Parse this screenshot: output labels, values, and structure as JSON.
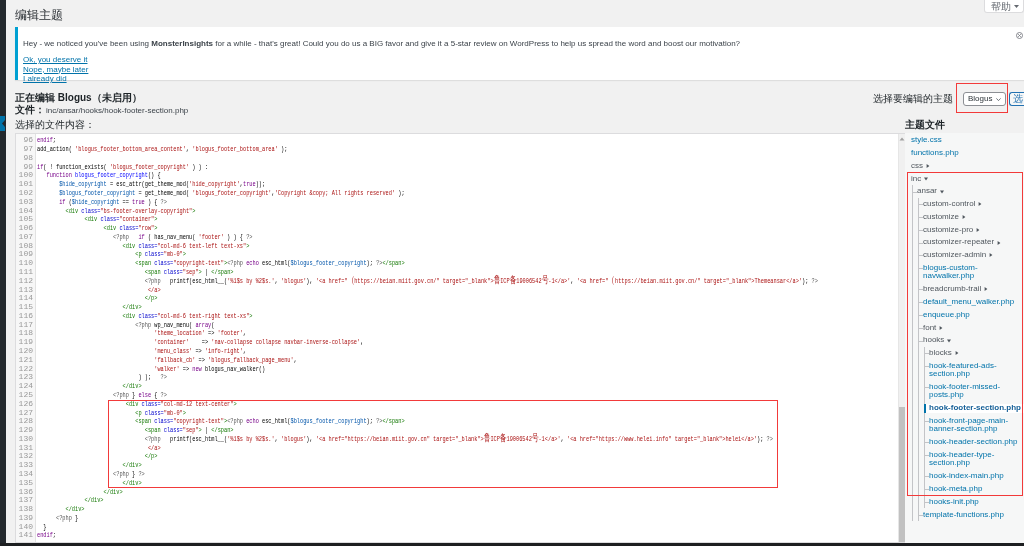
{
  "page": {
    "title": "编辑主题",
    "help_button": "帮助"
  },
  "notice": {
    "message": "Hey - we noticed you've been using **MonsterInsights** for a while - that's great! Could you do us a BIG favor and give it a 5-star review on WordPress to help us spread the word and boost our motivation?",
    "links": [
      "Ok, you deserve it",
      "Nope, maybe later",
      "I already did"
    ]
  },
  "editor_header": {
    "title": "正在编辑 Blogus（未启用）",
    "file_label": "文件：",
    "file_path": "inc/ansar/hooks/hook-footer-section.php",
    "theme_picker": {
      "label": "选择要编辑的主题",
      "value": "Blogus",
      "button": "选"
    }
  },
  "code_editor": {
    "label": "选择的文件内容：",
    "lines": [
      {
        "number": "96",
        "tokens": [
          {
            "kind": "keyword",
            "text": "endif"
          },
          {
            "kind": "plain",
            "text": ";"
          }
        ]
      },
      {
        "number": "97",
        "tokens": [
          {
            "kind": "plain",
            "text": "add_action( "
          },
          {
            "kind": "string",
            "text": "'blogus_footer_bottom_area_content'"
          },
          {
            "kind": "plain",
            "text": ", "
          },
          {
            "kind": "string",
            "text": "'blogus_footer_bottom_area'"
          },
          {
            "kind": "plain",
            "text": " );"
          }
        ]
      },
      {
        "number": "98"
      },
      {
        "number": "99",
        "tokens": [
          {
            "kind": "keyword",
            "text": "if"
          },
          {
            "kind": "plain",
            "text": "( ! function_exists( "
          },
          {
            "kind": "string",
            "text": "'blogus_footer_copyright'"
          },
          {
            "kind": "plain",
            "text": " ) ) :"
          }
        ]
      },
      {
        "number": "100",
        "tokens": [
          {
            "kind": "keyword",
            "text": "   function "
          },
          {
            "kind": "def",
            "text": "blogus_footer_copyright"
          },
          {
            "kind": "plain",
            "text": "() {"
          }
        ]
      },
      {
        "number": "101",
        "tokens": [
          {
            "kind": "variable",
            "text": "       $hide_copyright"
          },
          {
            "kind": "plain",
            "text": " = esc_attr(get_theme_mod("
          },
          {
            "kind": "string",
            "text": "'hide_copyright'"
          },
          {
            "kind": "plain",
            "text": ","
          },
          {
            "kind": "keyword",
            "text": "true"
          },
          {
            "kind": "plain",
            "text": "));"
          }
        ]
      },
      {
        "number": "102",
        "tokens": [
          {
            "kind": "variable",
            "text": "       $blogus_footer_copyright"
          },
          {
            "kind": "plain",
            "text": " = get_theme_mod( "
          },
          {
            "kind": "string",
            "text": "'blogus_footer_copyright'"
          },
          {
            "kind": "plain",
            "text": ","
          },
          {
            "kind": "string",
            "text": "'Copyright &copy; All rights reserved'"
          },
          {
            "kind": "plain",
            "text": " );"
          }
        ]
      },
      {
        "number": "103",
        "tokens": [
          {
            "kind": "keyword",
            "text": "       if"
          },
          {
            "kind": "plain",
            "text": " ("
          },
          {
            "kind": "variable",
            "text": "$hide_copyright"
          },
          {
            "kind": "plain",
            "text": " == "
          },
          {
            "kind": "keyword",
            "text": "true"
          },
          {
            "kind": "plain",
            "text": " ) { "
          },
          {
            "kind": "meta",
            "text": "?>"
          }
        ]
      },
      {
        "number": "104",
        "tokens": [
          {
            "kind": "tag",
            "text": "         <div "
          },
          {
            "kind": "attribute",
            "text": "class="
          },
          {
            "kind": "string",
            "text": "\"bs-footer-overlay-copyright\""
          },
          {
            "kind": "tag",
            "text": ">"
          }
        ]
      },
      {
        "number": "105",
        "tokens": [
          {
            "kind": "tag",
            "text": "               <div "
          },
          {
            "kind": "attribute",
            "text": "class="
          },
          {
            "kind": "string",
            "text": "\"container\""
          },
          {
            "kind": "tag",
            "text": ">"
          }
        ]
      },
      {
        "number": "106",
        "tokens": [
          {
            "kind": "tag",
            "text": "                     <div "
          },
          {
            "kind": "attribute",
            "text": "class="
          },
          {
            "kind": "string",
            "text": "\"row\""
          },
          {
            "kind": "tag",
            "text": ">"
          }
        ]
      },
      {
        "number": "107",
        "tokens": [
          {
            "kind": "meta",
            "text": "                        <?php   "
          },
          {
            "kind": "keyword",
            "text": "if"
          },
          {
            "kind": "plain",
            "text": " ( has_nav_menu( "
          },
          {
            "kind": "string",
            "text": "'footer'"
          },
          {
            "kind": "plain",
            "text": " ) ) { "
          },
          {
            "kind": "meta",
            "text": "?>"
          }
        ]
      },
      {
        "number": "108",
        "tokens": [
          {
            "kind": "tag",
            "text": "                           <div "
          },
          {
            "kind": "attribute",
            "text": "class="
          },
          {
            "kind": "string",
            "text": "\"col-md-6 text-left text-xs\""
          },
          {
            "kind": "tag",
            "text": ">"
          }
        ]
      },
      {
        "number": "109",
        "tokens": [
          {
            "kind": "tag",
            "text": "                               <p "
          },
          {
            "kind": "attribute",
            "text": "class="
          },
          {
            "kind": "string",
            "text": "\"mb-0\""
          },
          {
            "kind": "tag",
            "text": ">"
          }
        ]
      },
      {
        "number": "110",
        "tokens": [
          {
            "kind": "tag",
            "text": "                               <span "
          },
          {
            "kind": "attribute",
            "text": "class="
          },
          {
            "kind": "string",
            "text": "\"copyright-text\""
          },
          {
            "kind": "tag",
            "text": ">"
          },
          {
            "kind": "meta",
            "text": "<?php "
          },
          {
            "kind": "keyword",
            "text": "echo"
          },
          {
            "kind": "plain",
            "text": " esc_html("
          },
          {
            "kind": "variable",
            "text": "$blogus_footer_copyright"
          },
          {
            "kind": "plain",
            "text": "); "
          },
          {
            "kind": "meta",
            "text": "?>"
          },
          {
            "kind": "tag",
            "text": "</span>"
          }
        ]
      },
      {
        "number": "111",
        "tokens": [
          {
            "kind": "tag",
            "text": "                                  <span "
          },
          {
            "kind": "attribute",
            "text": "class="
          },
          {
            "kind": "string",
            "text": "\"sep\""
          },
          {
            "kind": "tag",
            "text": ">"
          },
          {
            "kind": "plain",
            "text": " | "
          },
          {
            "kind": "tag",
            "text": "</span>"
          }
        ]
      },
      {
        "number": "112",
        "tokens": [
          {
            "kind": "meta",
            "text": "                                  <?php"
          },
          {
            "kind": "plain",
            "text": "   printf(esc_html__("
          },
          {
            "kind": "string",
            "text": "'%1$s by %2$s.'"
          },
          {
            "kind": "plain",
            "text": ", "
          },
          {
            "kind": "string",
            "text": "'blogus'"
          },
          {
            "kind": "plain",
            "text": "), "
          },
          {
            "kind": "string",
            "text": "'<a href=\"（https://beian.miit.gov.cn/\" target=\"_blank\">鲁ICP备19006542号-1</a>'"
          },
          {
            "kind": "plain",
            "text": ", "
          },
          {
            "kind": "string",
            "text": "'<a href=\"（https://beian.miit.gov.cn/\" target=\"_blank\">Themeansar</a>'"
          },
          {
            "kind": "plain",
            "text": "); "
          },
          {
            "kind": "meta",
            "text": "?>"
          }
        ]
      },
      {
        "number": "113",
        "tokens": [
          {
            "kind": "string",
            "text": "                                   </a>"
          }
        ]
      },
      {
        "number": "114",
        "tokens": [
          {
            "kind": "tag",
            "text": "                                  </p>"
          }
        ]
      },
      {
        "number": "115",
        "tokens": [
          {
            "kind": "tag",
            "text": "                           </div>"
          }
        ]
      },
      {
        "number": "116",
        "tokens": [
          {
            "kind": "tag",
            "text": "                           <div "
          },
          {
            "kind": "attribute",
            "text": "class="
          },
          {
            "kind": "string",
            "text": "\"col-md-6 text-right text-xs\""
          },
          {
            "kind": "tag",
            "text": ">"
          }
        ]
      },
      {
        "number": "117",
        "tokens": [
          {
            "kind": "meta",
            "text": "                               <?php"
          },
          {
            "kind": "plain",
            "text": " wp_nav_menu( "
          },
          {
            "kind": "keyword",
            "text": "array"
          },
          {
            "kind": "plain",
            "text": "("
          }
        ]
      },
      {
        "number": "118",
        "tokens": [
          {
            "kind": "string",
            "text": "                                     'theme_location'"
          },
          {
            "kind": "plain",
            "text": " => "
          },
          {
            "kind": "string",
            "text": "'footer'"
          },
          {
            "kind": "plain",
            "text": ","
          }
        ]
      },
      {
        "number": "119",
        "tokens": [
          {
            "kind": "string",
            "text": "                                     'container'"
          },
          {
            "kind": "plain",
            "text": "    => "
          },
          {
            "kind": "string",
            "text": "'nav-collapse collapse navbar-inverse-collapse'"
          },
          {
            "kind": "plain",
            "text": ","
          }
        ]
      },
      {
        "number": "120",
        "tokens": [
          {
            "kind": "string",
            "text": "                                     'menu_class'"
          },
          {
            "kind": "plain",
            "text": " => "
          },
          {
            "kind": "string",
            "text": "'info-right'"
          },
          {
            "kind": "plain",
            "text": ","
          }
        ]
      },
      {
        "number": "121",
        "tokens": [
          {
            "kind": "string",
            "text": "                                     'fallback_cb'"
          },
          {
            "kind": "plain",
            "text": " => "
          },
          {
            "kind": "string",
            "text": "'blogus_fallback_page_menu'"
          },
          {
            "kind": "plain",
            "text": ","
          }
        ]
      },
      {
        "number": "122",
        "tokens": [
          {
            "kind": "string",
            "text": "                                     'walker'"
          },
          {
            "kind": "plain",
            "text": " => "
          },
          {
            "kind": "keyword",
            "text": "new"
          },
          {
            "kind": "plain",
            "text": " blogus_nav_walker()"
          }
        ]
      },
      {
        "number": "123",
        "tokens": [
          {
            "kind": "plain",
            "text": "                                ) );   "
          },
          {
            "kind": "meta",
            "text": "?>"
          }
        ]
      },
      {
        "number": "124",
        "tokens": [
          {
            "kind": "tag",
            "text": "                           </div>"
          }
        ]
      },
      {
        "number": "125",
        "tokens": [
          {
            "kind": "meta",
            "text": "                        <?php"
          },
          {
            "kind": "plain",
            "text": " } "
          },
          {
            "kind": "keyword",
            "text": "else"
          },
          {
            "kind": "plain",
            "text": " { "
          },
          {
            "kind": "meta",
            "text": "?>"
          }
        ]
      },
      {
        "number": "126",
        "tokens": [
          {
            "kind": "tag",
            "text": "                            <div "
          },
          {
            "kind": "attribute",
            "text": "class="
          },
          {
            "kind": "string",
            "text": "\"col-md-12 text-center\""
          },
          {
            "kind": "tag",
            "text": ">"
          }
        ]
      },
      {
        "number": "127",
        "tokens": [
          {
            "kind": "tag",
            "text": "                               <p "
          },
          {
            "kind": "attribute",
            "text": "class="
          },
          {
            "kind": "string",
            "text": "\"mb-0\""
          },
          {
            "kind": "tag",
            "text": ">"
          }
        ]
      },
      {
        "number": "128",
        "tokens": [
          {
            "kind": "tag",
            "text": "                               <span "
          },
          {
            "kind": "attribute",
            "text": "class="
          },
          {
            "kind": "string",
            "text": "\"copyright-text\""
          },
          {
            "kind": "tag",
            "text": ">"
          },
          {
            "kind": "meta",
            "text": "<?php "
          },
          {
            "kind": "keyword",
            "text": "echo"
          },
          {
            "kind": "plain",
            "text": " esc_html("
          },
          {
            "kind": "variable",
            "text": "$blogus_footer_copyright"
          },
          {
            "kind": "plain",
            "text": "); "
          },
          {
            "kind": "meta",
            "text": "?>"
          },
          {
            "kind": "tag",
            "text": "</span>"
          }
        ]
      },
      {
        "number": "129",
        "tokens": [
          {
            "kind": "tag",
            "text": "                                  <span "
          },
          {
            "kind": "attribute",
            "text": "class="
          },
          {
            "kind": "string",
            "text": "\"sep\""
          },
          {
            "kind": "tag",
            "text": ">"
          },
          {
            "kind": "plain",
            "text": " | "
          },
          {
            "kind": "tag",
            "text": "</span>"
          }
        ]
      },
      {
        "number": "130",
        "tokens": [
          {
            "kind": "meta",
            "text": "                                  <?php"
          },
          {
            "kind": "plain",
            "text": "   printf(esc_html__("
          },
          {
            "kind": "string",
            "text": "'%1$s by %2$s.'"
          },
          {
            "kind": "plain",
            "text": ", "
          },
          {
            "kind": "string",
            "text": "'blogus'"
          },
          {
            "kind": "plain",
            "text": "), "
          },
          {
            "kind": "string",
            "text": "'<a href=\"https://beian.miit.gov.cn\" target=\"_blank\">鲁ICP备19006542号-1</a>'"
          },
          {
            "kind": "plain",
            "text": ", "
          },
          {
            "kind": "string",
            "text": "'<a href=\"https://www.helei.info\" target=\"_blank\">helei</a>'"
          },
          {
            "kind": "plain",
            "text": "); "
          },
          {
            "kind": "meta",
            "text": "?>"
          }
        ]
      },
      {
        "number": "131",
        "tokens": [
          {
            "kind": "string",
            "text": "                                   </a>"
          }
        ]
      },
      {
        "number": "132",
        "tokens": [
          {
            "kind": "tag",
            "text": "                                  </p>"
          }
        ]
      },
      {
        "number": "133",
        "tokens": [
          {
            "kind": "tag",
            "text": "                           </div>"
          }
        ]
      },
      {
        "number": "134",
        "tokens": [
          {
            "kind": "meta",
            "text": "                        <?php"
          },
          {
            "kind": "plain",
            "text": " } "
          },
          {
            "kind": "meta",
            "text": "?>"
          }
        ]
      },
      {
        "number": "135",
        "tokens": [
          {
            "kind": "tag",
            "text": "                           </div>"
          }
        ]
      },
      {
        "number": "136",
        "tokens": [
          {
            "kind": "tag",
            "text": "                     </div>"
          }
        ]
      },
      {
        "number": "137",
        "tokens": [
          {
            "kind": "tag",
            "text": "               </div>"
          }
        ]
      },
      {
        "number": "138",
        "tokens": [
          {
            "kind": "tag",
            "text": "         </div>"
          }
        ]
      },
      {
        "number": "139",
        "tokens": [
          {
            "kind": "meta",
            "text": "      <?php"
          },
          {
            "kind": "plain",
            "text": " }"
          }
        ]
      },
      {
        "number": "140",
        "tokens": [
          {
            "kind": "plain",
            "text": "  }"
          }
        ]
      },
      {
        "number": "141",
        "tokens": [
          {
            "kind": "keyword",
            "text": "endif"
          },
          {
            "kind": "plain",
            "text": ";"
          }
        ]
      }
    ]
  },
  "file_tree": {
    "title": "主题文件",
    "items": [
      {
        "label": "style.css",
        "kind": "file",
        "selected": false
      },
      {
        "label": "functions.php",
        "kind": "file",
        "selected": false
      },
      {
        "label": "css",
        "kind": "folder",
        "expanded": false,
        "selected": false
      },
      {
        "label": "inc",
        "kind": "folder",
        "expanded": true,
        "selected": false,
        "children": [
          {
            "label": "ansar",
            "kind": "folder",
            "expanded": true,
            "selected": false,
            "children": [
              {
                "label": "custom-control",
                "kind": "folder",
                "expanded": false,
                "selected": false
              },
              {
                "label": "customize",
                "kind": "folder",
                "expanded": false,
                "selected": false
              },
              {
                "label": "customize-pro",
                "kind": "folder",
                "expanded": false,
                "selected": false
              },
              {
                "label": "customizer-repeater",
                "kind": "folder",
                "expanded": false,
                "selected": false
              },
              {
                "label": "customizer-admin",
                "kind": "folder",
                "expanded": false,
                "selected": false
              },
              {
                "label": "blogus-custom-navwalker.php",
                "kind": "file",
                "selected": false
              },
              {
                "label": "breadcrumb-trail",
                "kind": "folder",
                "expanded": false,
                "selected": false
              },
              {
                "label": "default_menu_walker.php",
                "kind": "file",
                "selected": false
              },
              {
                "label": "enqueue.php",
                "kind": "file",
                "selected": false
              },
              {
                "label": "font",
                "kind": "folder",
                "expanded": false,
                "selected": false
              },
              {
                "label": "hooks",
                "kind": "folder",
                "expanded": true,
                "selected": false,
                "children": [
                  {
                    "label": "blocks",
                    "kind": "folder",
                    "expanded": false,
                    "selected": false
                  },
                  {
                    "label": "hook-featured-ads-section.php",
                    "kind": "file",
                    "selected": false
                  },
                  {
                    "label": "hook-footer-missed-posts.php",
                    "kind": "file",
                    "selected": false
                  },
                  {
                    "label": "hook-footer-section.php",
                    "kind": "file",
                    "selected": true
                  },
                  {
                    "label": "hook-front-page-main-banner-section.php",
                    "kind": "file",
                    "selected": false
                  },
                  {
                    "label": "hook-header-section.php",
                    "kind": "file",
                    "selected": false
                  },
                  {
                    "label": "hook-header-type-section.php",
                    "kind": "file",
                    "selected": false
                  },
                  {
                    "label": "hook-index-main.php",
                    "kind": "file",
                    "selected": false
                  },
                  {
                    "label": "hook-meta.php",
                    "kind": "file",
                    "selected": false
                  },
                  {
                    "label": "hooks-init.php",
                    "kind": "file",
                    "selected": false
                  }
                ]
              },
              {
                "label": "template-functions.php",
                "kind": "file",
                "selected": false
              }
            ]
          }
        ]
      }
    ]
  }
}
